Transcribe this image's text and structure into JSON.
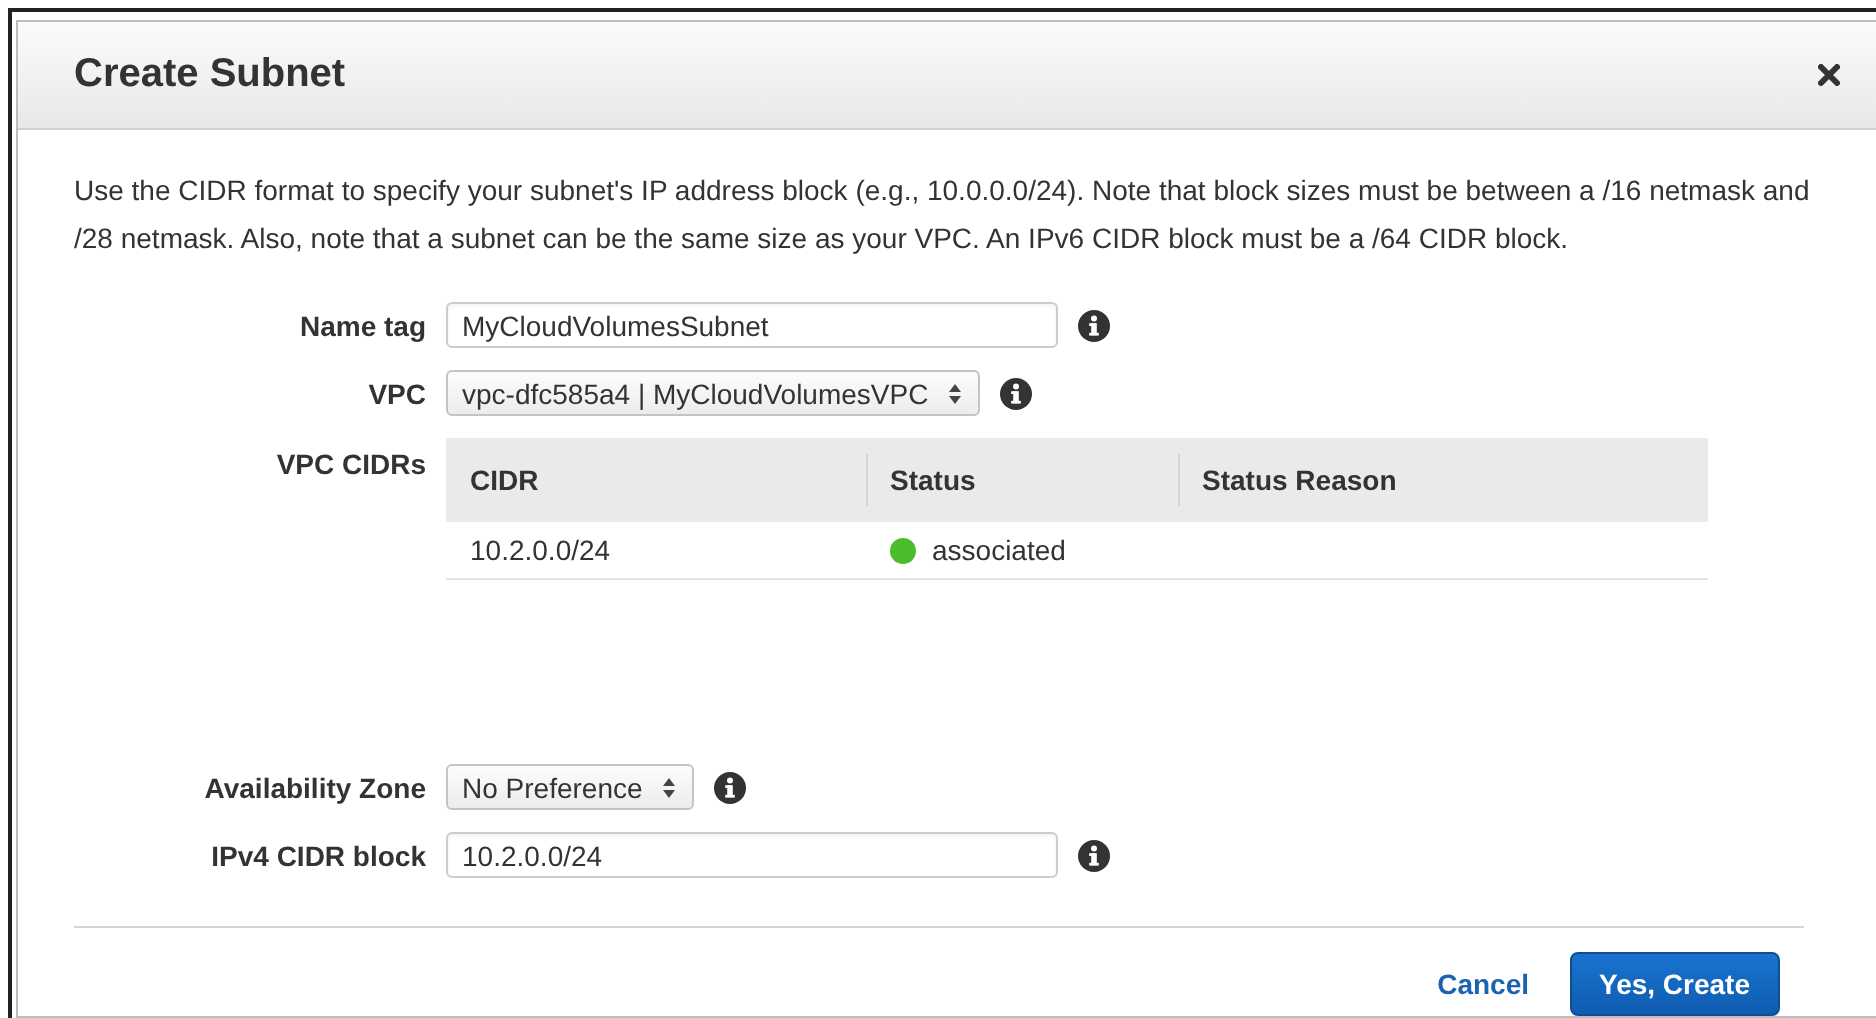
{
  "dialog": {
    "title": "Create Subnet",
    "description": "Use the CIDR format to specify your subnet's IP address block (e.g., 10.0.0.0/24). Note that block sizes must be between a /16 netmask and /28 netmask. Also, note that a subnet can be the same size as your VPC. An IPv6 CIDR block must be a /64 CIDR block.",
    "fields": [
      {
        "kind": "text",
        "label": "Name tag",
        "value": "MyCloudVolumesSubnet"
      },
      {
        "kind": "select",
        "label": "VPC",
        "value": "vpc-dfc585a4 | MyCloudVolumesVPC"
      },
      {
        "kind": "table",
        "label": "VPC CIDRs",
        "columns": [
          "CIDR",
          "Status",
          "Status Reason"
        ],
        "rows": [
          {
            "cidr": "10.2.0.0/24",
            "status": "associated",
            "color": "#4cbb2c"
          }
        ]
      },
      {
        "kind": "select",
        "label": "Availability Zone",
        "value": "No Preference"
      },
      {
        "kind": "text",
        "label": "IPv4 CIDR block",
        "value": "10.2.0.0/24"
      }
    ],
    "buttons": [
      {
        "kind": "link",
        "label": "Cancel"
      },
      {
        "kind": "primary",
        "label": "Yes, Create"
      }
    ]
  }
}
